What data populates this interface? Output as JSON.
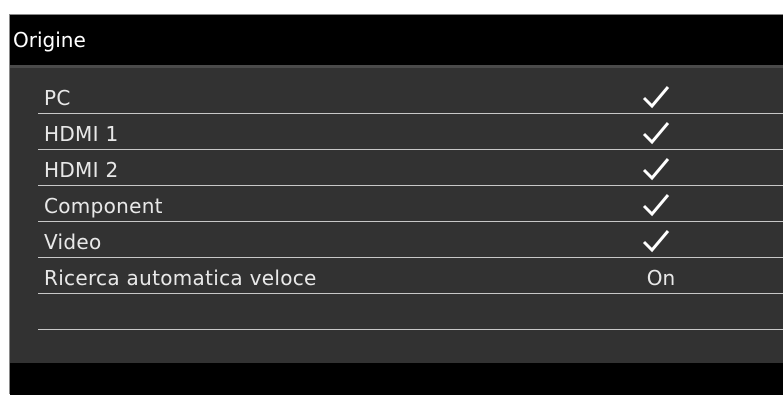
{
  "window": {
    "title": "Origine"
  },
  "menu": {
    "items": [
      {
        "label": "PC",
        "value_type": "check",
        "checked": true
      },
      {
        "label": "HDMI 1",
        "value_type": "check",
        "checked": true
      },
      {
        "label": "HDMI 2",
        "value_type": "check",
        "checked": true
      },
      {
        "label": "Component",
        "value_type": "check",
        "checked": true
      },
      {
        "label": "Video",
        "value_type": "check",
        "checked": true
      },
      {
        "label": "Ricerca automatica veloce",
        "value_type": "text",
        "value": "On"
      },
      {
        "label": "",
        "value_type": "none"
      }
    ]
  },
  "colors": {
    "panel_bg": "#323232",
    "title_bg": "#000000",
    "text": "#e8e8e8",
    "divider": "#c8c8c8"
  },
  "icons": {
    "check": "checkmark-icon"
  }
}
